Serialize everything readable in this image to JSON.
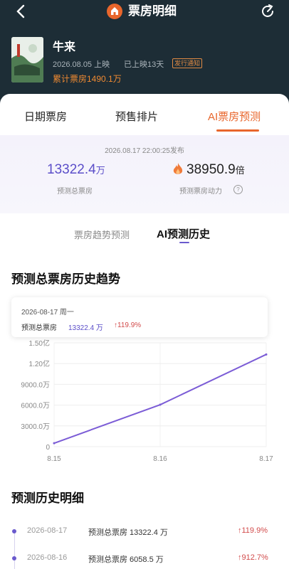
{
  "header": {
    "back_icon": "chevron-left-icon",
    "logo_icon": "house-icon",
    "title": "票房明细",
    "refresh_icon": "refresh-icon"
  },
  "movie": {
    "name": "牛来",
    "release": "2026.08.05 上映",
    "showing": "已上映13天",
    "notify_label": "发行通知",
    "cumulative": "累计票房1490.1万"
  },
  "tabs": [
    {
      "label": "日期票房"
    },
    {
      "label": "预售排片"
    },
    {
      "label": "AI票房预测"
    }
  ],
  "forecast": {
    "publish_time": "2026.08.17 22:00:25发布",
    "total_value": "13322.4",
    "total_unit": "万",
    "total_label": "预测总票房",
    "power_value": "38950.9",
    "power_unit": "倍",
    "power_label": "预测票房动力"
  },
  "subtabs": [
    {
      "label": "票房趋势预测"
    },
    {
      "label": "AI预测历史"
    }
  ],
  "trend_section": {
    "title": "预测总票房历史趋势",
    "tooltip": {
      "date": "2026-08-17  周一",
      "label": "预测总票房",
      "value": "13322.4 万",
      "change": "↑119.9%"
    }
  },
  "chart_data": {
    "type": "line",
    "x": [
      "8.15",
      "8.16",
      "8.17"
    ],
    "series": [
      {
        "values": [
          500,
          6058.5,
          13322.4
        ]
      }
    ],
    "y_ticks": [
      "0",
      "3000.0万",
      "6000.0万",
      "9000.0万",
      "1.20亿",
      "1.50亿"
    ],
    "ylim": [
      0,
      15000
    ],
    "grid": true,
    "line_color": "#7b5cd6"
  },
  "history_section": {
    "title": "预测历史明细",
    "rows": [
      {
        "date": "2026-08-17",
        "text": "预测总票房 13322.4 万",
        "change": "↑119.9%"
      },
      {
        "date": "2026-08-16",
        "text": "预测总票房 6058.5 万",
        "change": "↑912.7%"
      }
    ]
  },
  "colors": {
    "accent": "#e8662c",
    "purple": "#5b4ec9",
    "up_red": "#d24b4b"
  }
}
